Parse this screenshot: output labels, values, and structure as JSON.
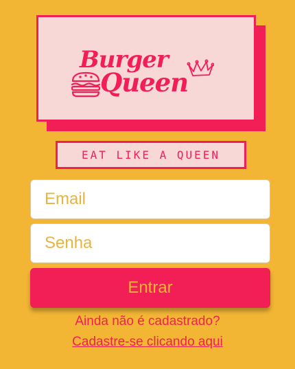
{
  "brand": {
    "line1": "Burger",
    "line2": "Queen",
    "tagline": "EAT LIKE A QUEEN",
    "icons": [
      "burger-icon",
      "crown-icon"
    ]
  },
  "form": {
    "email_placeholder": "Email",
    "password_placeholder": "Senha",
    "submit_label": "Entrar"
  },
  "footer": {
    "question": "Ainda não é cadastrado?",
    "signup_link": "Cadastre-se clicando aqui"
  },
  "colors": {
    "background": "#F2B534",
    "accent": "#F21F56",
    "card": "#F8D7D7",
    "input_bg": "#FFFFFF"
  }
}
